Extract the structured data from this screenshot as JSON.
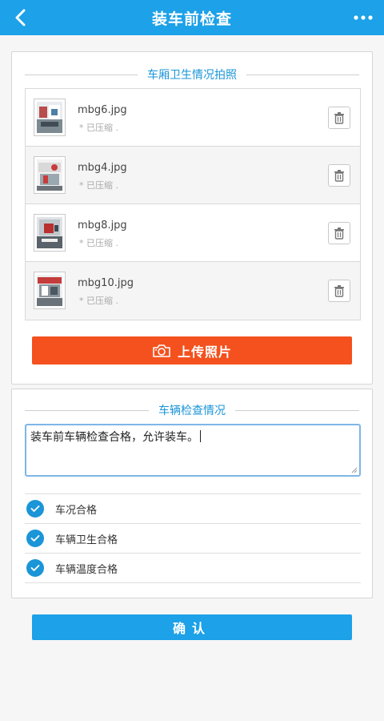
{
  "header": {
    "title": "装车前检查",
    "back_icon": "chevron-left-icon",
    "more_icon": "more-horizontal-icon",
    "color": "#1da1e8"
  },
  "photos_section": {
    "title": "车厢卫生情况拍照",
    "items": [
      {
        "filename": "mbg6.jpg",
        "note": "* 已压缩 ."
      },
      {
        "filename": "mbg4.jpg",
        "note": "* 已压缩 ."
      },
      {
        "filename": "mbg8.jpg",
        "note": "* 已压缩 ."
      },
      {
        "filename": "mbg10.jpg",
        "note": "* 已压缩 ."
      }
    ],
    "delete_icon": "trash-icon",
    "upload_button": {
      "label": "上传照片",
      "icon": "camera-icon",
      "color": "#f4511e"
    }
  },
  "inspection_section": {
    "title": "车辆检查情况",
    "textarea_value": "装车前车辆检查合格，允许装车。",
    "checks": [
      {
        "label": "车况合格",
        "checked": true
      },
      {
        "label": "车辆卫生合格",
        "checked": true
      },
      {
        "label": "车辆温度合格",
        "checked": true
      }
    ]
  },
  "confirm_button": {
    "label": "确认",
    "color": "#1da1e8"
  }
}
